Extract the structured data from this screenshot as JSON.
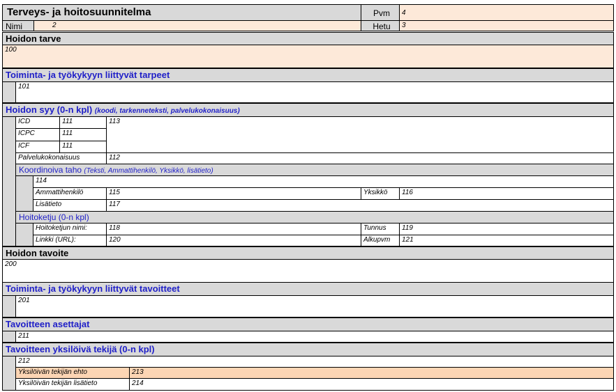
{
  "header": {
    "title": "Terveys- ja hoitosuunnitelma",
    "pvm_label": "Pvm",
    "pvm_value": "4",
    "nimi_label": "Nimi",
    "nimi_value": "2",
    "hetu_label": "Hetu",
    "hetu_value": "3"
  },
  "hoidon_tarve": {
    "heading": "Hoidon tarve",
    "value": "100"
  },
  "toiminta_tarpeet": {
    "heading": "Toiminta- ja työkykyyn liittyvät tarpeet",
    "value": "101"
  },
  "hoidon_syy": {
    "heading": "Hoidon syy (0-n kpl)",
    "heading_sub": "(koodi, tarkenneteksti, palvelukokonaisuus)",
    "codes": [
      {
        "label": "ICD",
        "value": "111"
      },
      {
        "label": "ICPC",
        "value": "111"
      },
      {
        "label": "ICF",
        "value": "111"
      }
    ],
    "tarkenne_value": "113",
    "palvelu_label": "Palvelukokonaisuus",
    "palvelu_value": "112",
    "koordinoiva": {
      "heading": "Koordinoiva taho",
      "heading_sub": "(Teksti, Ammattihenkilö, Yksikkö, lisätieto)",
      "text_value": "114",
      "ammatti_label": "Ammattihenkilö",
      "ammatti_value": "115",
      "yksikko_label": "Yksikkö",
      "yksikko_value": "116",
      "lisatieto_label": "Lisätieto",
      "lisatieto_value": "117"
    },
    "hoitoketju": {
      "heading": "Hoitoketju (0-n kpl)",
      "nimi_label": "Hoitoketjun nimi:",
      "nimi_value": "118",
      "tunnus_label": "Tunnus",
      "tunnus_value": "119",
      "linkki_label": "Linkki (URL):",
      "linkki_value": "120",
      "alkupvm_label": "Alkupvm",
      "alkupvm_value": "121"
    }
  },
  "hoidon_tavoite": {
    "heading": "Hoidon tavoite",
    "value": "200"
  },
  "toiminta_tavoitteet": {
    "heading": "Toiminta- ja työkykyyn liittyvät tavoitteet",
    "value": "201"
  },
  "asettajat": {
    "heading": "Tavoitteen asettajat",
    "value": "211"
  },
  "yksiloiva": {
    "heading": "Tavoitteen yksilöivä tekijä (0-n kpl)",
    "value": "212",
    "ehto_label": "Yksilöivän tekijän ehto",
    "ehto_value": "213",
    "lisatieto_label": "Yksilöivän tekijän lisätieto",
    "lisatieto_value": "214"
  },
  "colors": {
    "gray": "#d9d9d9",
    "peach": "#fde9d9",
    "blue_heading": "#1f1fc8",
    "ehto_row": "#fcd5b4"
  }
}
